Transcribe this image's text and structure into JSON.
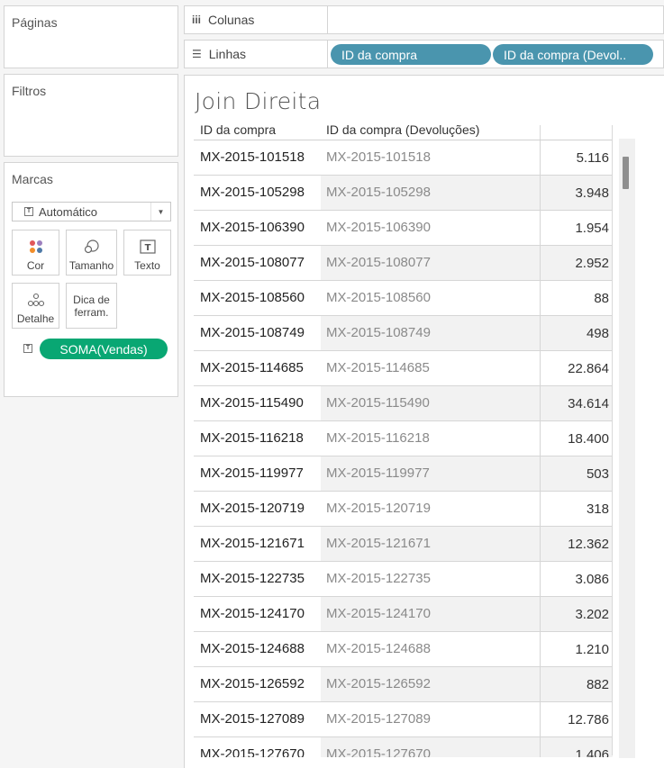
{
  "left_panel": {
    "pages_title": "Páginas",
    "filters_title": "Filtros",
    "marks": {
      "title": "Marcas",
      "mark_type": "Automático",
      "cards": {
        "cor": "Cor",
        "tamanho": "Tamanho",
        "texto": "Texto",
        "detalhe": "Detalhe",
        "dica_line1": "Dica de",
        "dica_line2": "ferram."
      },
      "field_pill": "SOMA(Vendas)",
      "field_pill_color": "#09a773"
    }
  },
  "shelves": {
    "columns_label": "Colunas",
    "rows_label": "Linhas",
    "row_pills": [
      "ID da compra",
      "ID da compra (Devol.."
    ],
    "row_pill_color": "#4a95ae"
  },
  "view": {
    "title": "Join Direita",
    "headers": [
      "ID da compra",
      "ID da compra (Devoluções)"
    ],
    "rows": [
      {
        "id": "MX-2015-101518",
        "id_dev": "MX-2015-101518",
        "value": "5.116"
      },
      {
        "id": "MX-2015-105298",
        "id_dev": "MX-2015-105298",
        "value": "3.948"
      },
      {
        "id": "MX-2015-106390",
        "id_dev": "MX-2015-106390",
        "value": "1.954"
      },
      {
        "id": "MX-2015-108077",
        "id_dev": "MX-2015-108077",
        "value": "2.952"
      },
      {
        "id": "MX-2015-108560",
        "id_dev": "MX-2015-108560",
        "value": "88"
      },
      {
        "id": "MX-2015-108749",
        "id_dev": "MX-2015-108749",
        "value": "498"
      },
      {
        "id": "MX-2015-114685",
        "id_dev": "MX-2015-114685",
        "value": "22.864"
      },
      {
        "id": "MX-2015-115490",
        "id_dev": "MX-2015-115490",
        "value": "34.614"
      },
      {
        "id": "MX-2015-116218",
        "id_dev": "MX-2015-116218",
        "value": "18.400"
      },
      {
        "id": "MX-2015-119977",
        "id_dev": "MX-2015-119977",
        "value": "503"
      },
      {
        "id": "MX-2015-120719",
        "id_dev": "MX-2015-120719",
        "value": "318"
      },
      {
        "id": "MX-2015-121671",
        "id_dev": "MX-2015-121671",
        "value": "12.362"
      },
      {
        "id": "MX-2015-122735",
        "id_dev": "MX-2015-122735",
        "value": "3.086"
      },
      {
        "id": "MX-2015-124170",
        "id_dev": "MX-2015-124170",
        "value": "3.202"
      },
      {
        "id": "MX-2015-124688",
        "id_dev": "MX-2015-124688",
        "value": "1.210"
      },
      {
        "id": "MX-2015-126592",
        "id_dev": "MX-2015-126592",
        "value": "882"
      },
      {
        "id": "MX-2015-127089",
        "id_dev": "MX-2015-127089",
        "value": "12.786"
      },
      {
        "id": "MX-2015-127670",
        "id_dev": "MX-2015-127670",
        "value": "1.406"
      }
    ]
  }
}
